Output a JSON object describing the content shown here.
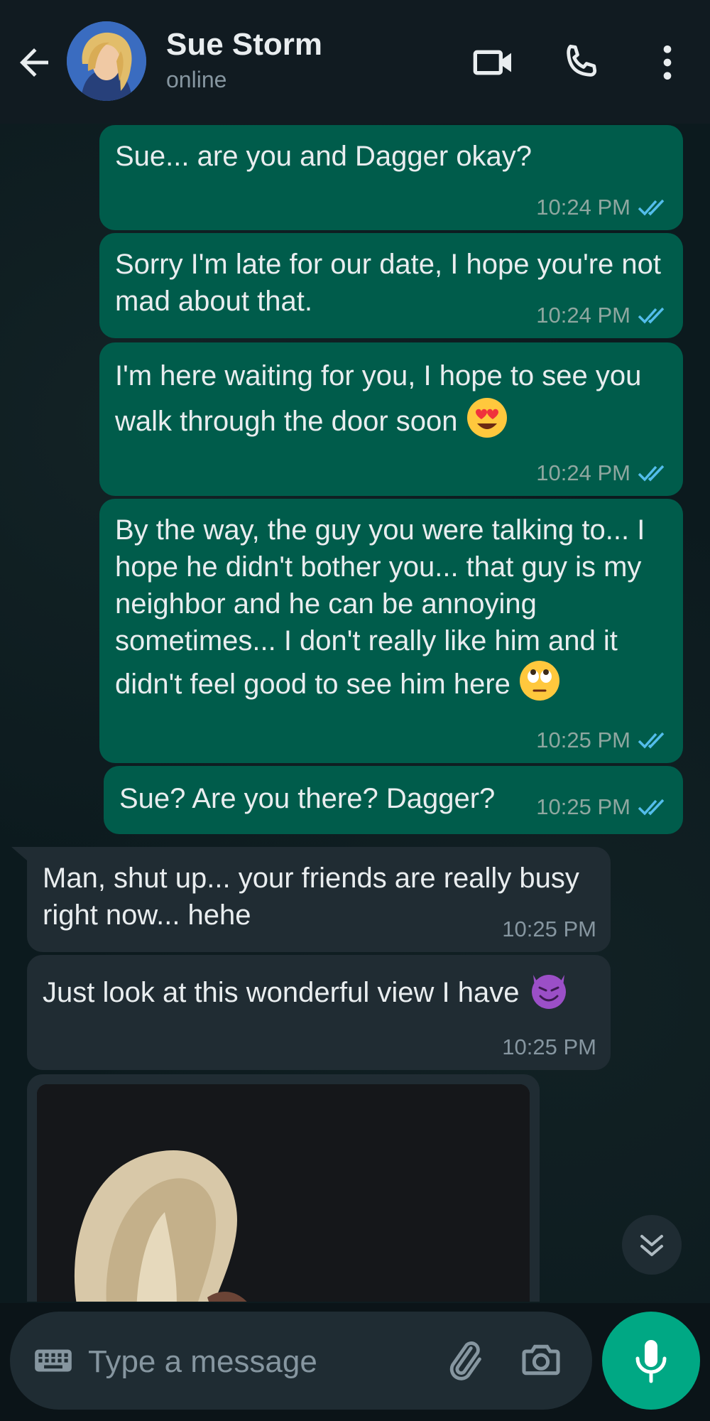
{
  "header": {
    "name": "Sue Storm",
    "status": "online"
  },
  "messages": [
    {
      "dir": "out",
      "text": "Sue... are you and Dagger okay?",
      "time": "10:24 PM"
    },
    {
      "dir": "out",
      "text": "Sorry I'm late for our date, I hope you're not mad about that.",
      "time": "10:24 PM"
    },
    {
      "dir": "out",
      "text": "I'm here waiting for you, I hope to see you walk through the door soon",
      "emoji": "heart-eyes-emoji",
      "time": "10:24 PM"
    },
    {
      "dir": "out",
      "text": "By the way, the guy you were talking to... I hope he didn't bother you... that guy is my neighbor and he can be annoying sometimes... I don't really like him and it didn't feel good to see him here",
      "emoji": "eye-roll-emoji",
      "time": "10:25 PM"
    },
    {
      "dir": "out",
      "text": "Sue? Are you there? Dagger?",
      "time": "10:25 PM"
    },
    {
      "dir": "in",
      "text": "Man, shut up... your friends are really busy right now... hehe",
      "time": "10:25 PM"
    },
    {
      "dir": "in",
      "text": "Just look at this wonderful view I have",
      "emoji": "smiling-devil-emoji",
      "time": "10:25 PM"
    }
  ],
  "composer": {
    "placeholder": "Type a message"
  },
  "colors": {
    "outgoing_bubble": "#005c4b",
    "incoming_bubble": "#202c33",
    "read_ticks": "#53bdeb",
    "accent": "#00a884"
  }
}
